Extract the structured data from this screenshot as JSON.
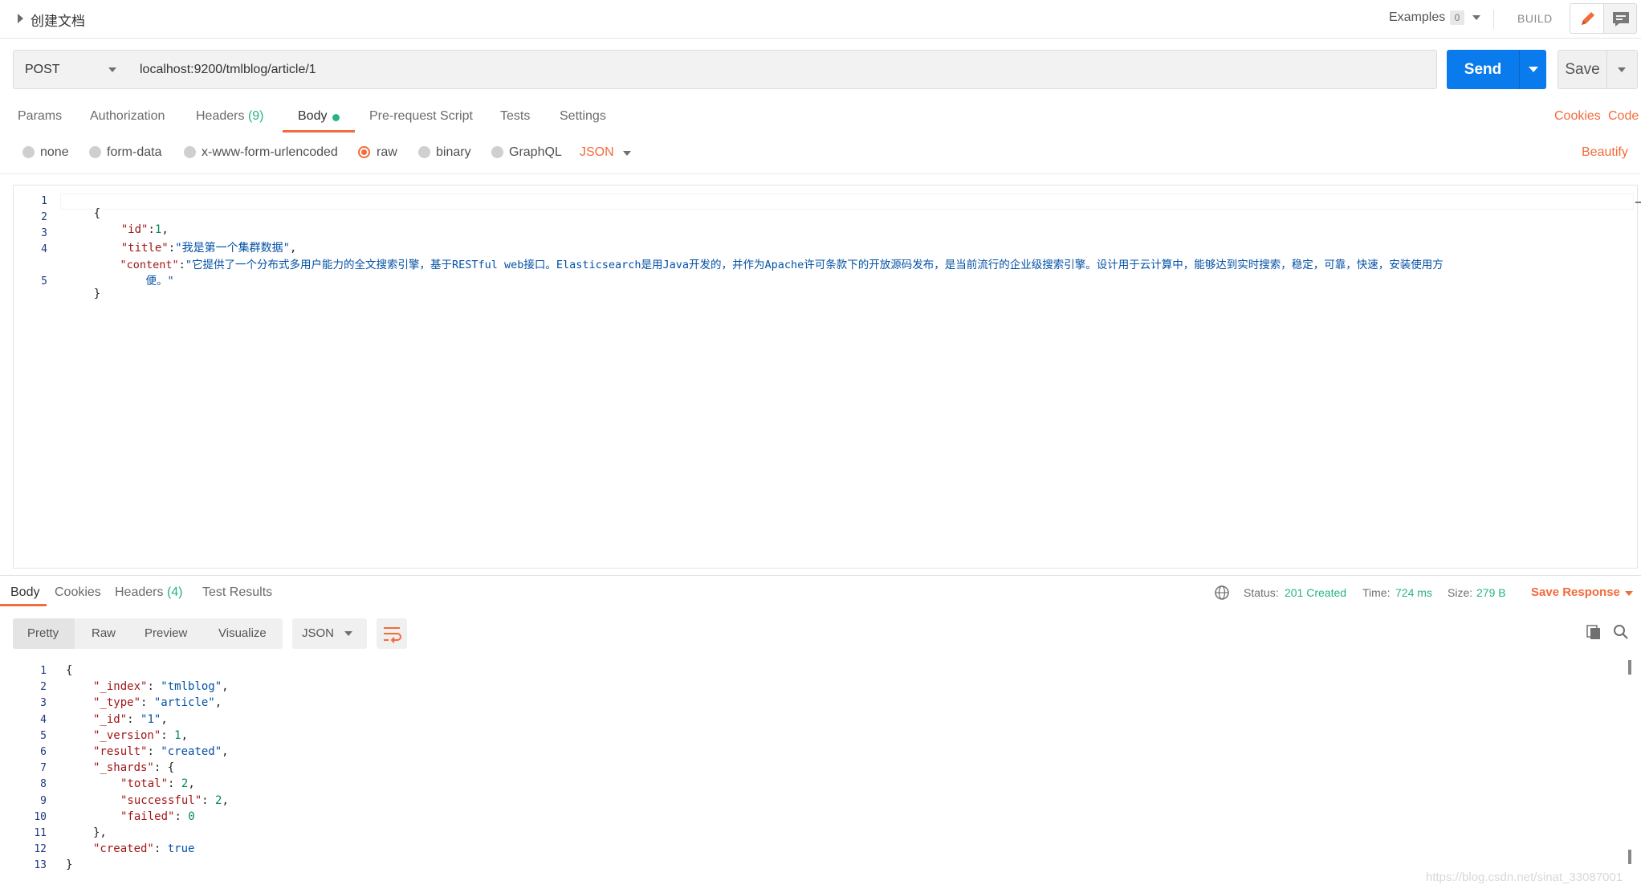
{
  "request": {
    "name": "创建文档",
    "examples_label": "Examples",
    "examples_count": "0",
    "build_label": "BUILD",
    "method": "POST",
    "url": "localhost:9200/tmlblog/article/1",
    "send_label": "Send",
    "save_label": "Save"
  },
  "request_tabs": [
    {
      "label": "Params"
    },
    {
      "label": "Authorization"
    },
    {
      "label": "Headers",
      "count": "(9)"
    },
    {
      "label": "Body"
    },
    {
      "label": "Pre-request Script"
    },
    {
      "label": "Tests"
    },
    {
      "label": "Settings"
    }
  ],
  "links": {
    "cookies": "Cookies",
    "code": "Code",
    "beautify": "Beautify"
  },
  "body_types": [
    {
      "label": "none",
      "selected": false
    },
    {
      "label": "form-data",
      "selected": false
    },
    {
      "label": "x-www-form-urlencoded",
      "selected": false
    },
    {
      "label": "raw",
      "selected": true
    },
    {
      "label": "binary",
      "selected": false
    },
    {
      "label": "GraphQL",
      "selected": false
    }
  ],
  "body_format": "JSON",
  "request_body": {
    "line_numbers": [
      "1",
      "2",
      "3",
      "4",
      "5"
    ],
    "l1": "{",
    "l2_key": "\"id\"",
    "l2_colon": ":",
    "l2_val": "1",
    "l2_end": ",",
    "l3_key": "\"title\"",
    "l3_colon": ":",
    "l3_val": "\"我是第一个集群数据\"",
    "l3_end": ",",
    "l4_key": "\"content\"",
    "l4_colon": ":",
    "l4_val_a": "\"它提供了一个分布式多用户能力的全文搜索引擎，基于RESTful web接口。Elasticsearch是用Java开发的，并作为Apache许可条款下的开放源码发布，是当前流行的企业级搜索引擎。设计用于云计算中，能够达到实时搜索，稳定，可靠，快速，安装使用方",
    "l4_val_b": "便。\"",
    "l5": "}"
  },
  "response_tabs": [
    {
      "label": "Body"
    },
    {
      "label": "Cookies"
    },
    {
      "label": "Headers",
      "count": "(4)"
    },
    {
      "label": "Test Results"
    }
  ],
  "response_meta": {
    "status_label": "Status:",
    "status_value": "201 Created",
    "time_label": "Time:",
    "time_value": "724 ms",
    "size_label": "Size:",
    "size_value": "279 B",
    "save_response": "Save Response"
  },
  "view_modes": [
    "Pretty",
    "Raw",
    "Preview",
    "Visualize"
  ],
  "response_format": "JSON",
  "response_body": {
    "line_numbers": [
      "1",
      "2",
      "3",
      "4",
      "5",
      "6",
      "7",
      "8",
      "9",
      "10",
      "11",
      "12",
      "13"
    ],
    "lines": [
      [
        {
          "t": "{",
          "c": "p"
        }
      ],
      [
        {
          "t": "\"_index\"",
          "c": "k"
        },
        {
          "t": ": ",
          "c": "p"
        },
        {
          "t": "\"tmlblog\"",
          "c": "s"
        },
        {
          "t": ",",
          "c": "p"
        }
      ],
      [
        {
          "t": "\"_type\"",
          "c": "k"
        },
        {
          "t": ": ",
          "c": "p"
        },
        {
          "t": "\"article\"",
          "c": "s"
        },
        {
          "t": ",",
          "c": "p"
        }
      ],
      [
        {
          "t": "\"_id\"",
          "c": "k"
        },
        {
          "t": ": ",
          "c": "p"
        },
        {
          "t": "\"1\"",
          "c": "s"
        },
        {
          "t": ",",
          "c": "p"
        }
      ],
      [
        {
          "t": "\"_version\"",
          "c": "k"
        },
        {
          "t": ": ",
          "c": "p"
        },
        {
          "t": "1",
          "c": "n"
        },
        {
          "t": ",",
          "c": "p"
        }
      ],
      [
        {
          "t": "\"result\"",
          "c": "k"
        },
        {
          "t": ": ",
          "c": "p"
        },
        {
          "t": "\"created\"",
          "c": "s"
        },
        {
          "t": ",",
          "c": "p"
        }
      ],
      [
        {
          "t": "\"_shards\"",
          "c": "k"
        },
        {
          "t": ": {",
          "c": "p"
        }
      ],
      [
        {
          "t": "\"total\"",
          "c": "k"
        },
        {
          "t": ": ",
          "c": "p"
        },
        {
          "t": "2",
          "c": "n"
        },
        {
          "t": ",",
          "c": "p"
        }
      ],
      [
        {
          "t": "\"successful\"",
          "c": "k"
        },
        {
          "t": ": ",
          "c": "p"
        },
        {
          "t": "2",
          "c": "n"
        },
        {
          "t": ",",
          "c": "p"
        }
      ],
      [
        {
          "t": "\"failed\"",
          "c": "k"
        },
        {
          "t": ": ",
          "c": "p"
        },
        {
          "t": "0",
          "c": "n"
        }
      ],
      [
        {
          "t": "},",
          "c": "p"
        }
      ],
      [
        {
          "t": "\"created\"",
          "c": "k"
        },
        {
          "t": ": ",
          "c": "p"
        },
        {
          "t": "true",
          "c": "s"
        }
      ],
      [
        {
          "t": "}",
          "c": "p"
        }
      ]
    ]
  },
  "watermark": "https://blog.csdn.net/sinat_33087001",
  "colors": {
    "accent": "#f26b3a",
    "primary": "#097bed",
    "success": "#26b47f"
  }
}
